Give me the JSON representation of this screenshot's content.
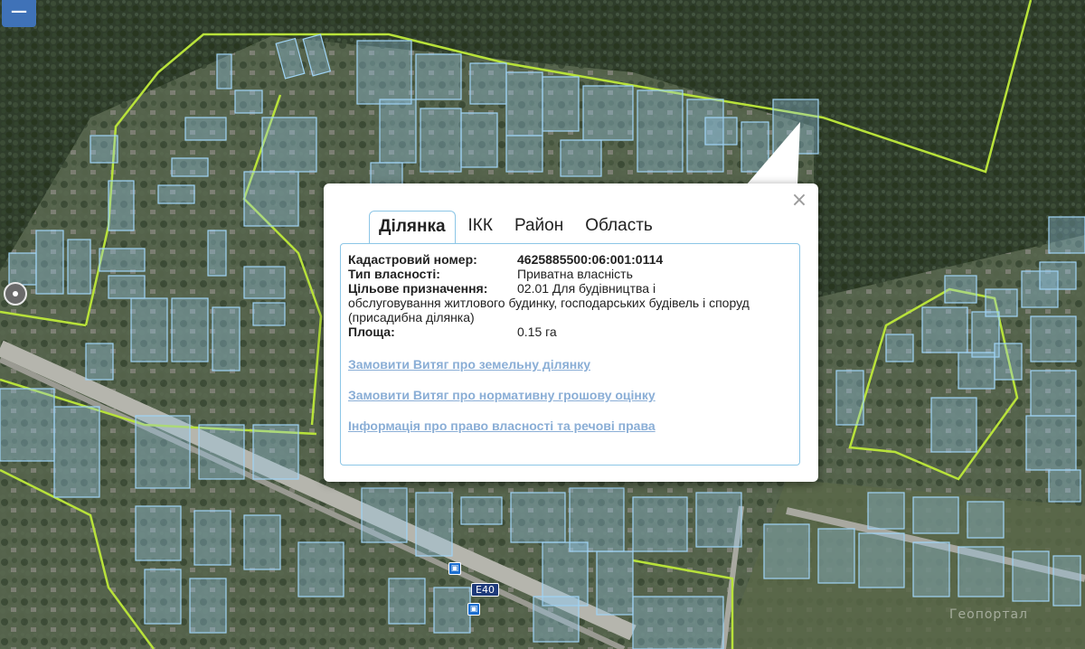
{
  "map": {
    "zoom_out_label": "−",
    "road_label": "Е40",
    "watermark": "Геoпортал",
    "colors": {
      "forest": "#2f3d2b",
      "parcel_fill": "#a9cde8",
      "parcel_stroke": "#9fd3f5",
      "boundary": "#b8e23a",
      "road": "#bfbfbf"
    }
  },
  "popup": {
    "close_label": "×",
    "tabs": [
      {
        "label": "Ділянка",
        "active": true
      },
      {
        "label": "ІКК",
        "active": false
      },
      {
        "label": "Район",
        "active": false
      },
      {
        "label": "Область",
        "active": false
      }
    ],
    "fields": {
      "cadastral_label": "Кадастровий номер:",
      "cadastral_value": "4625885500:06:001:0114",
      "ownership_label": "Тип власності:",
      "ownership_value": "Приватна власність",
      "purpose_label": "Цільове призначення:",
      "purpose_value_line1": "02.01 Для будівництва і",
      "purpose_value_rest": "обслуговування житлового будинку, господарських будівель і споруд (присадибна ділянка)",
      "area_label": "Площа:",
      "area_value": "0.15 га"
    },
    "links": [
      "Замовити Витяг про земельну ділянку",
      "Замовити Витяг про нормативну грошову оцінку",
      "Інформація про право власності та речові права"
    ]
  }
}
